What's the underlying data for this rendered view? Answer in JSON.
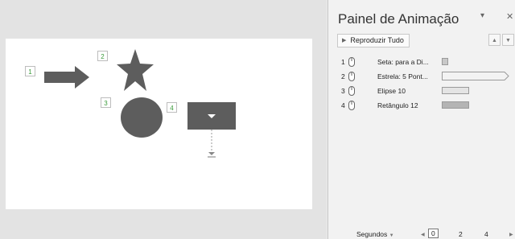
{
  "slide": {
    "tags": [
      "1",
      "2",
      "3",
      "4"
    ]
  },
  "pane": {
    "title": "Painel de Animação",
    "play_all_label": "Reproduzir Tudo",
    "items": [
      {
        "number": "1",
        "label": "Seta: para a Di..."
      },
      {
        "number": "2",
        "label": "Estrela: 5 Pont..."
      },
      {
        "number": "3",
        "label": "Elipse 10"
      },
      {
        "number": "4",
        "label": "Retângulo 12"
      }
    ],
    "timeline": {
      "units_label": "Segundos",
      "ticks": [
        "0",
        "2",
        "4"
      ]
    }
  },
  "colors": {
    "shape_fill": "#5d5d5d",
    "tag_number": "#3a9a3a"
  },
  "icons": {
    "close": "close-icon",
    "menu": "dropdown-icon",
    "play": "play-icon",
    "mouse": "mouse-icon"
  }
}
